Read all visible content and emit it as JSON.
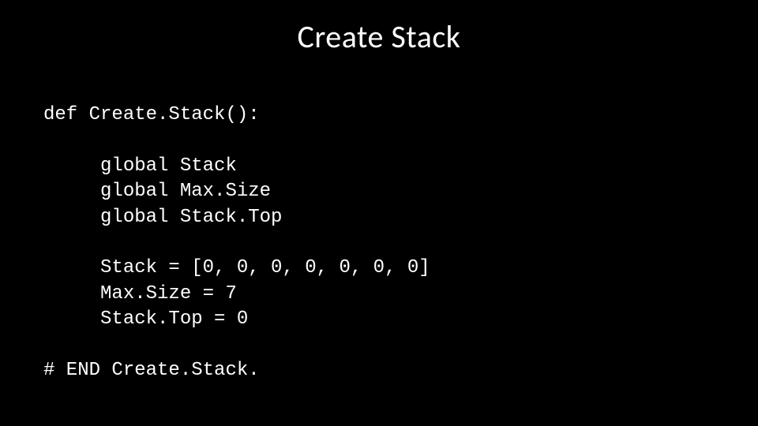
{
  "slide": {
    "title": "Create Stack"
  },
  "code": {
    "line1": "def Create.Stack():",
    "line2": "",
    "line3": "     global Stack",
    "line4": "     global Max.Size",
    "line5": "     global Stack.Top",
    "line6": "",
    "line7": "     Stack = [0, 0, 0, 0, 0, 0, 0]",
    "line8": "     Max.Size = 7",
    "line9": "     Stack.Top = 0",
    "line10": "",
    "line11": "# END Create.Stack."
  }
}
